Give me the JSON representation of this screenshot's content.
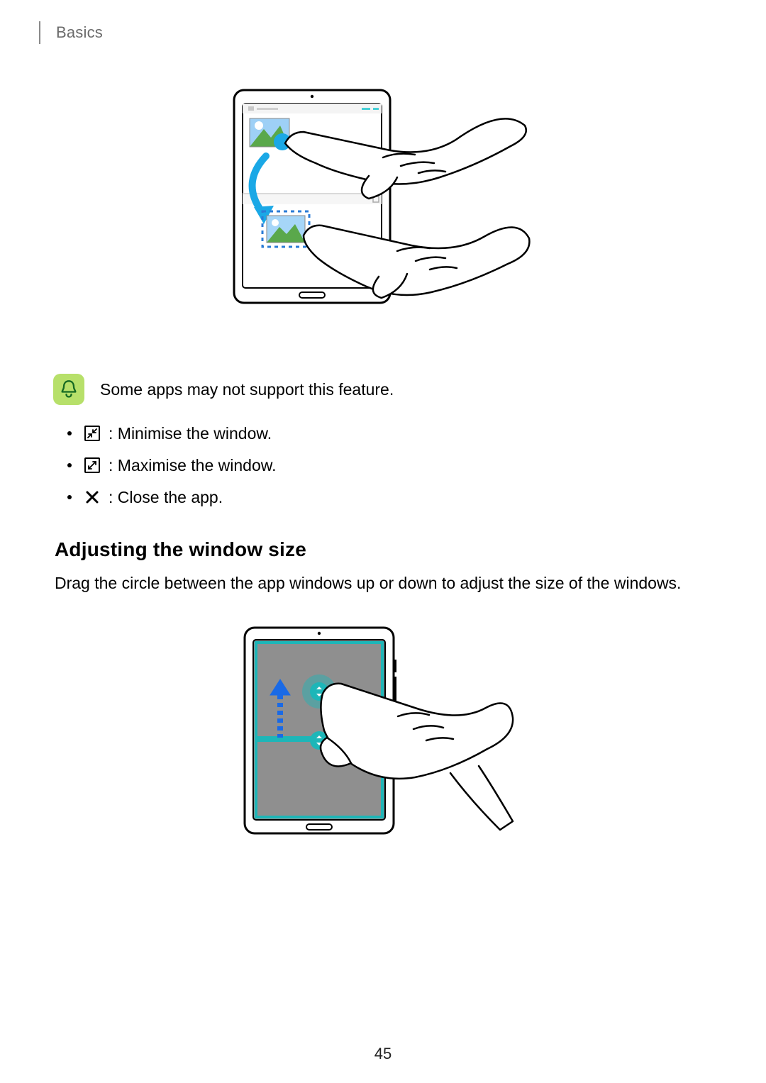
{
  "header": {
    "section_label": "Basics"
  },
  "note": {
    "text": "Some apps may not support this feature."
  },
  "icon_list": [
    {
      "label": ": Minimise the window."
    },
    {
      "label": ": Maximise the window."
    },
    {
      "label": ": Close the app."
    }
  ],
  "section": {
    "heading": "Adjusting the window size",
    "body": "Drag the circle between the app windows up or down to adjust the size of the windows."
  },
  "page_number": "45"
}
